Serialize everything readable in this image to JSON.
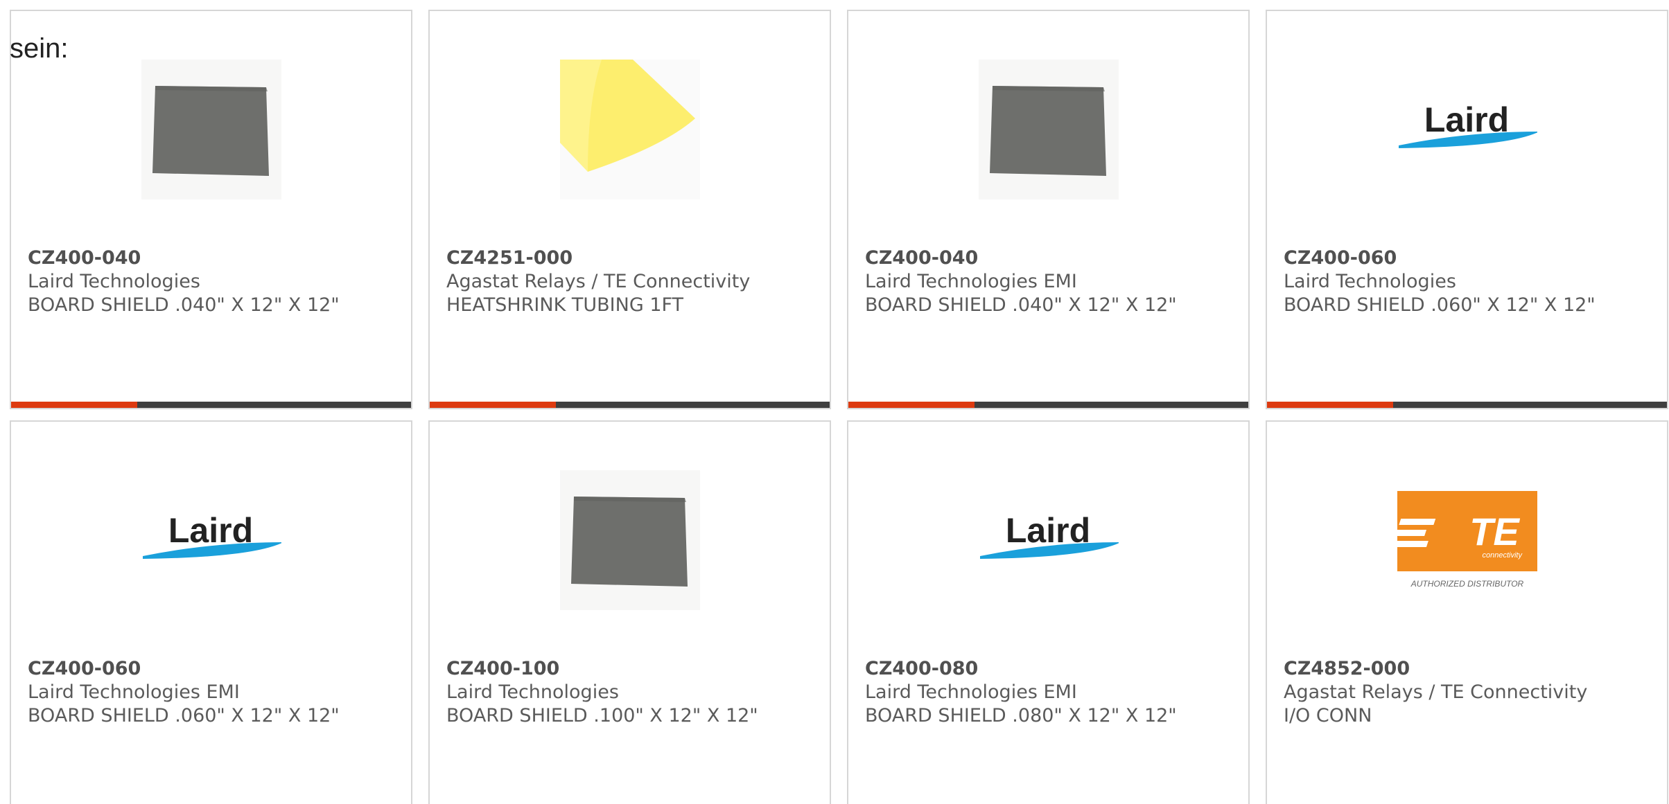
{
  "intro_text": "sein:",
  "products": [
    {
      "part_number": "CZ400-040",
      "manufacturer": "Laird Technologies",
      "description": "BOARD SHIELD .040\" X 12\" X 12\"",
      "image": "gray-sheet"
    },
    {
      "part_number": "CZ4251-000",
      "manufacturer": "Agastat Relays / TE Connectivity",
      "description": "HEATSHRINK TUBING 1FT",
      "image": "yellow-tubing"
    },
    {
      "part_number": "CZ400-040",
      "manufacturer": "Laird Technologies EMI",
      "description": "BOARD SHIELD .040\" X 12\" X 12\"",
      "image": "gray-sheet"
    },
    {
      "part_number": "CZ400-060",
      "manufacturer": "Laird Technologies",
      "description": "BOARD SHIELD .060\" X 12\" X 12\"",
      "image": "laird-logo"
    },
    {
      "part_number": "CZ400-060",
      "manufacturer": "Laird Technologies EMI",
      "description": "BOARD SHIELD .060\" X 12\" X 12\"",
      "image": "laird-logo"
    },
    {
      "part_number": "CZ400-100",
      "manufacturer": "Laird Technologies",
      "description": "BOARD SHIELD .100\" X 12\" X 12\"",
      "image": "gray-sheet"
    },
    {
      "part_number": "CZ400-080",
      "manufacturer": "Laird Technologies EMI",
      "description": "BOARD SHIELD .080\" X 12\" X 12\"",
      "image": "laird-logo"
    },
    {
      "part_number": "CZ4852-000",
      "manufacturer": "Agastat Relays / TE Connectivity",
      "description": "I/O CONN",
      "image": "te-logo"
    }
  ],
  "logos": {
    "laird_text": "Laird",
    "te_text": "TE",
    "te_sub": "connectivity",
    "te_caption": "AUTHORIZED DISTRIBUTOR"
  },
  "colors": {
    "accent": "#dd3a10",
    "bar": "#3f3f3f",
    "laird_swoosh": "#1aa0db",
    "te_orange": "#f28c1f",
    "sheet_gray": "#6e6f6c",
    "tubing_yellow": "#fdee6e"
  }
}
